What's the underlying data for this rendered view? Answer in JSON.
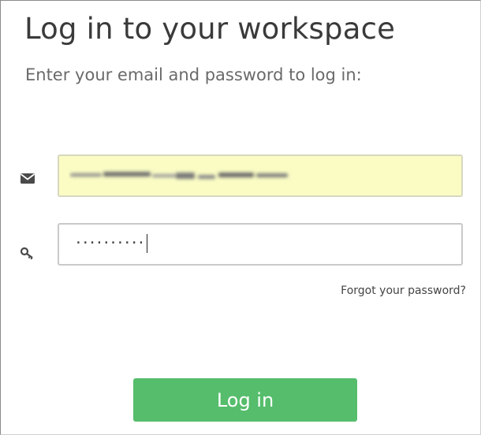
{
  "header": {
    "title": "Log in to your workspace",
    "subtitle": "Enter your email and password to log in:"
  },
  "form": {
    "email": {
      "icon": "envelope-icon",
      "value_obscured": true,
      "autofill_color": "#fafcc4"
    },
    "password": {
      "icon": "key-icon",
      "value": "··········"
    },
    "forgot_link": "Forgot your password?",
    "submit_label": "Log in"
  },
  "colors": {
    "accent": "#55bd6c",
    "title_text": "#3a3a3a",
    "subtitle_text": "#6a6a6a"
  }
}
